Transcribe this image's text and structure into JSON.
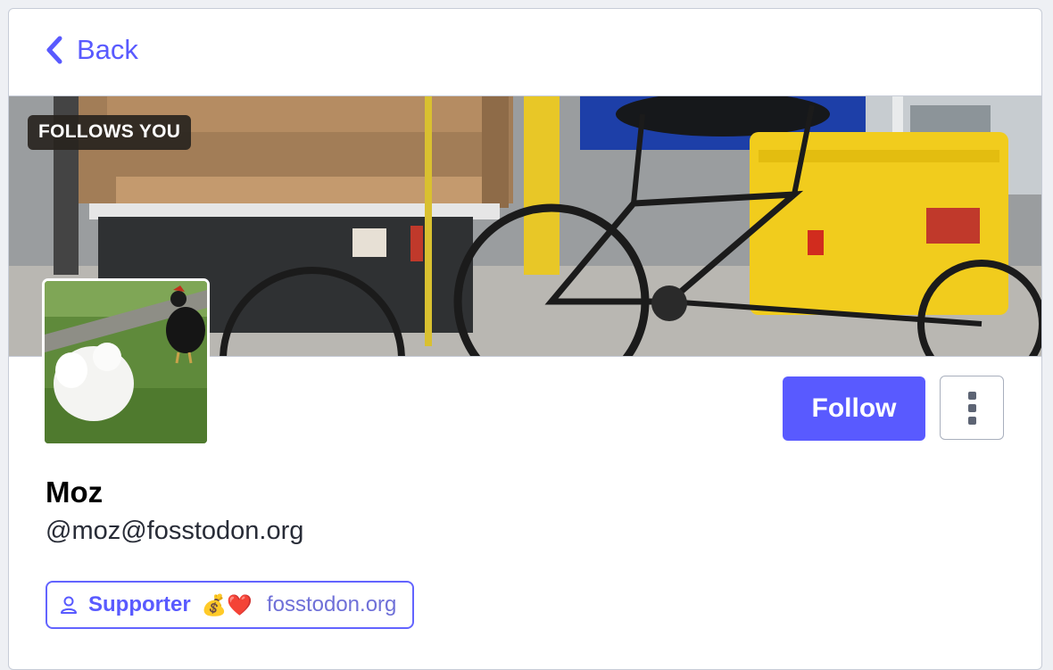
{
  "nav": {
    "back_label": "Back"
  },
  "profile": {
    "follows_you": "FOLLOWS YOU",
    "display_name": "Moz",
    "handle": "@moz@fosstodon.org",
    "follow_label": "Follow",
    "role": {
      "name": "Supporter",
      "emoji": "💰❤️",
      "domain": "fosstodon.org"
    }
  },
  "icons": {
    "back": "chevron-left-icon",
    "menu": "kebab-menu-icon",
    "role": "user-icon"
  },
  "colors": {
    "accent": "#595aff",
    "badge_background": "#28241e",
    "border": "#c7ccd7"
  }
}
